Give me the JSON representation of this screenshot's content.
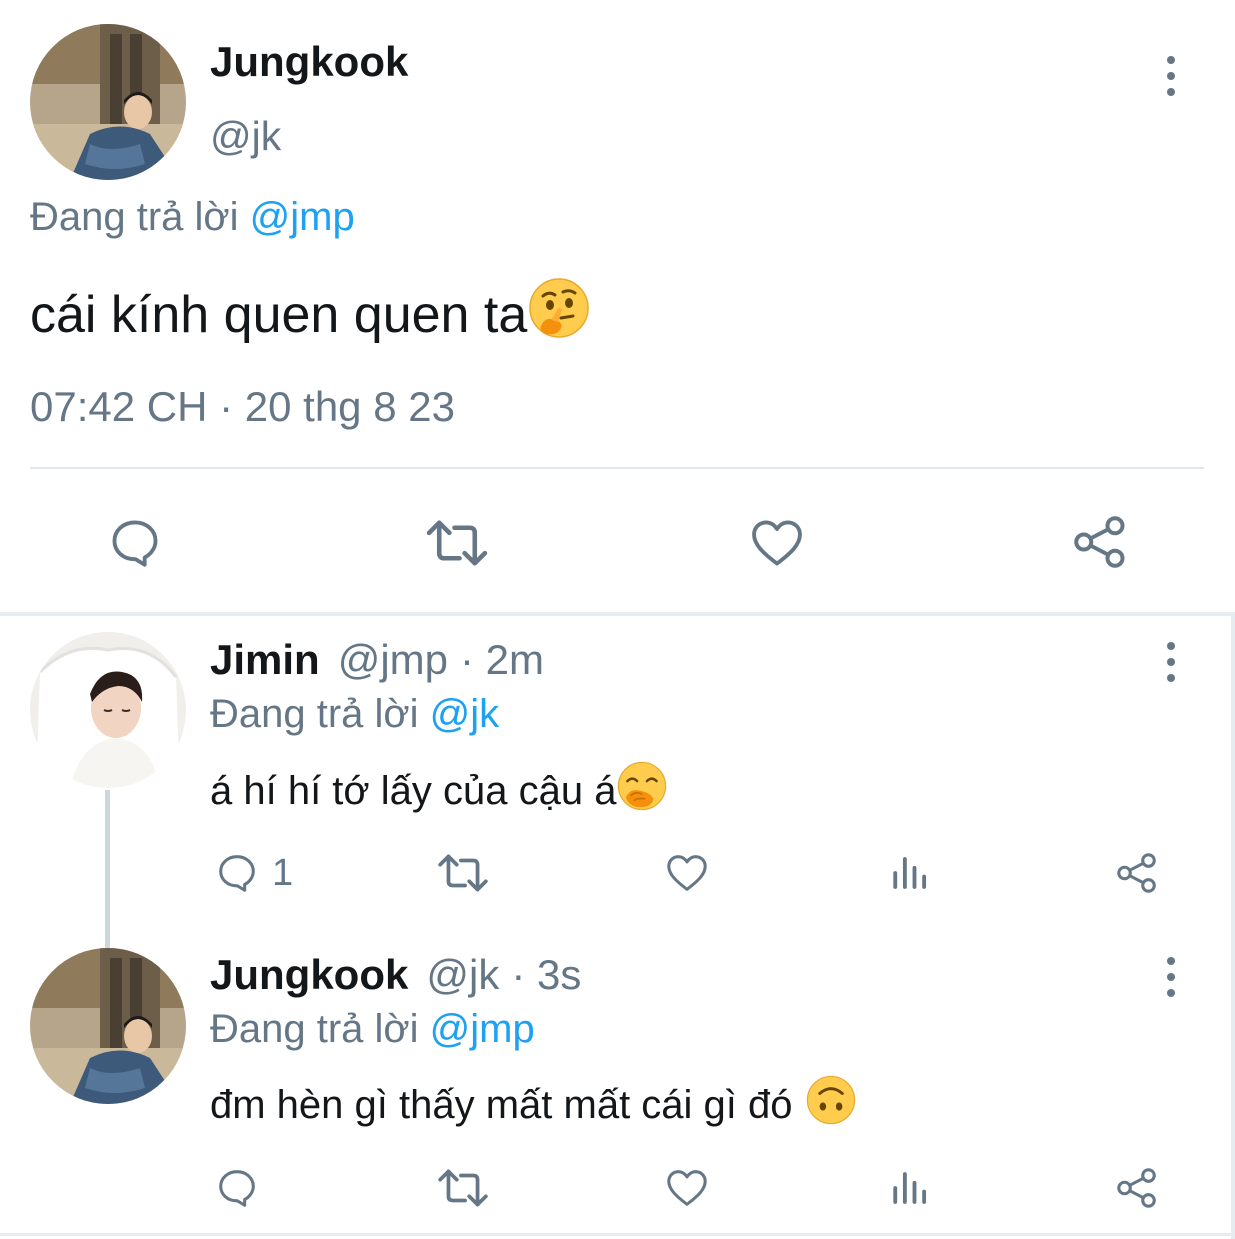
{
  "main_tweet": {
    "display_name": "Jungkook",
    "handle": "@jk",
    "replying_label": "Đang trả lời",
    "replying_to": "@jmp",
    "text": "cái kính quen quen ta",
    "emoji": "thinking-face",
    "timestamp": "07:42 CH · 20 thg 8 23"
  },
  "replies": [
    {
      "display_name": "Jimin",
      "handle": "@jmp",
      "time": "· 2m",
      "replying_label": "Đang trả lời",
      "replying_to": "@jk",
      "text": "á hí hí tớ lấy của cậu á",
      "emoji": "face-with-hand-over-mouth",
      "reply_count": "1"
    },
    {
      "display_name": "Jungkook",
      "handle": "@jk",
      "time": "· 3s",
      "replying_label": "Đang trả lời",
      "replying_to": "@jmp",
      "text": "đm hèn gì thấy mất mất cái gì đó",
      "emoji": "upside-down-face",
      "reply_count": ""
    }
  ],
  "colors": {
    "text_primary": "#14171a",
    "text_secondary": "#657786",
    "link": "#1da1f2",
    "divider": "#e1e8ed"
  }
}
